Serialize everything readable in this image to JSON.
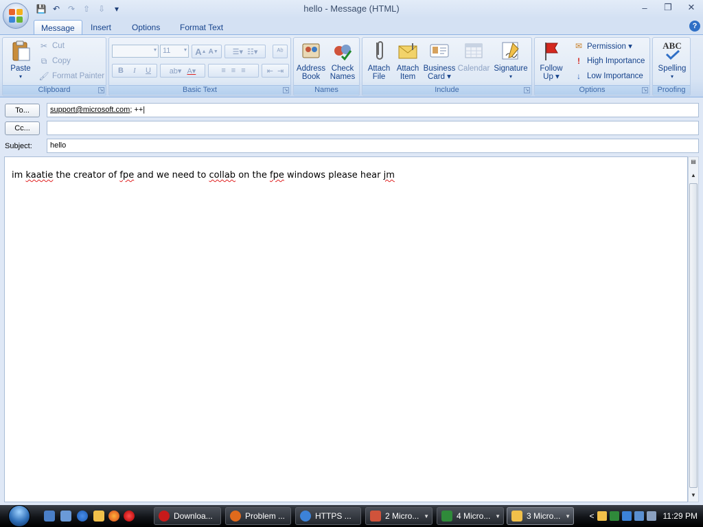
{
  "window": {
    "title": "hello - Message (HTML)",
    "minimize_glyph": "‒",
    "maximize_glyph": "❐",
    "close_glyph": "✕"
  },
  "qat": {
    "save": "💾",
    "undo": "↶",
    "redo": "↷",
    "up": "⇧",
    "down": "⇩",
    "more": "▾"
  },
  "tabs": [
    {
      "label": "Message"
    },
    {
      "label": "Insert"
    },
    {
      "label": "Options"
    },
    {
      "label": "Format Text"
    }
  ],
  "help_label": "?",
  "ribbon": {
    "clipboard": {
      "label": "Clipboard",
      "paste": "Paste",
      "cut": "Cut",
      "copy": "Copy",
      "format_painter": "Format Painter"
    },
    "basic_text": {
      "label": "Basic Text",
      "font_size": "11",
      "grow": "A",
      "shrink": "A",
      "bold": "B",
      "italic": "I",
      "underline": "U"
    },
    "names": {
      "label": "Names",
      "address_book_1": "Address",
      "address_book_2": "Book",
      "check_names_1": "Check",
      "check_names_2": "Names"
    },
    "include": {
      "label": "Include",
      "attach_file_1": "Attach",
      "attach_file_2": "File",
      "attach_item_1": "Attach",
      "attach_item_2": "Item",
      "business_card_1": "Business",
      "business_card_2": "Card ▾",
      "calendar": "Calendar",
      "signature_1": "Signature",
      "signature_2": "▾"
    },
    "options": {
      "label": "Options",
      "follow_up_1": "Follow",
      "follow_up_2": "Up ▾",
      "permission": "Permission ▾",
      "high_importance": "High Importance",
      "low_importance": "Low Importance"
    },
    "proofing": {
      "label": "Proofing",
      "spelling_1": "Spelling",
      "spelling_2": "▾",
      "abc": "ABC"
    }
  },
  "fields": {
    "to_button": "To...",
    "to_recipient": "support@microsoft.com",
    "to_rest": "; ++|",
    "cc_button": "Cc...",
    "cc_value": "",
    "subject_label": "Subject:",
    "subject_value": "hello"
  },
  "body": {
    "w1": "im",
    "w2": "kaatie",
    "w3": "the creator of",
    "w4": "fpe",
    "w5": "and we need to",
    "w6": "collab",
    "w7": "on the",
    "w8": "fpe",
    "w9": "windows please hear",
    "w10": "jm"
  },
  "taskbar": {
    "tasks": [
      {
        "label": "Downloa..."
      },
      {
        "label": "Problem ..."
      },
      {
        "label": "HTTPS ..."
      },
      {
        "label": "2 Micro..."
      },
      {
        "label": "4 Micro..."
      },
      {
        "label": "3 Micro..."
      }
    ],
    "clock": "11:29 PM",
    "tray_chevron": "<"
  }
}
